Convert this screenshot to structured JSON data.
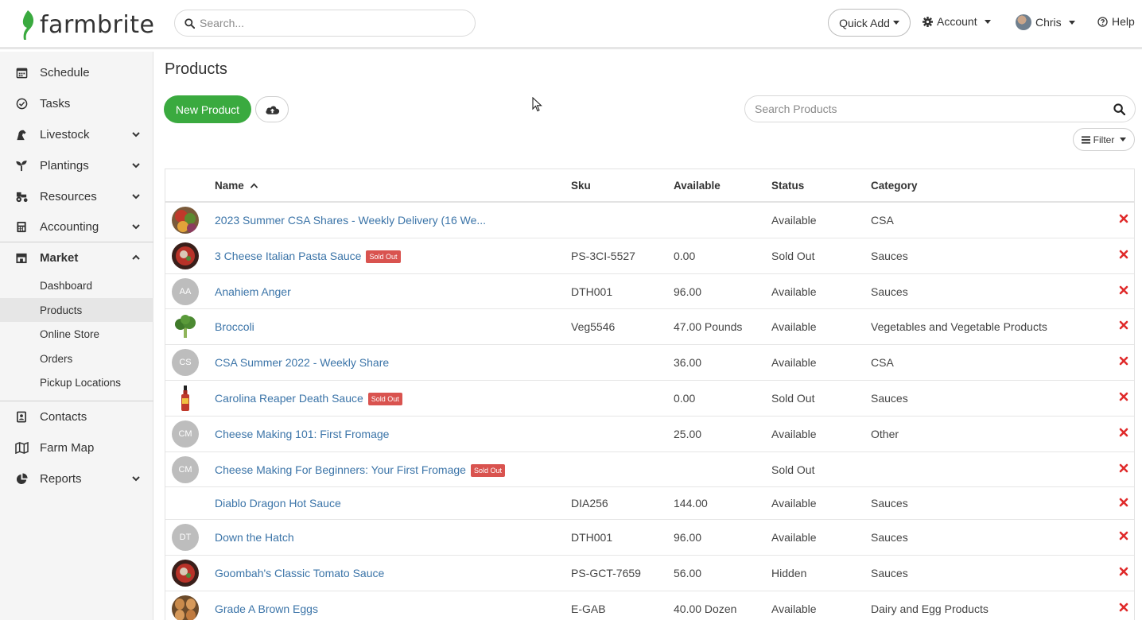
{
  "brand": {
    "name": "farmbrite",
    "accent": "#3aaa3f"
  },
  "header": {
    "search_placeholder": "Search...",
    "quick_add": "Quick Add",
    "account": "Account",
    "user": "Chris",
    "help": "Help"
  },
  "sidebar": {
    "items": [
      {
        "label": "Schedule",
        "icon": "calendar-icon"
      },
      {
        "label": "Tasks",
        "icon": "check-circle-icon"
      },
      {
        "label": "Livestock",
        "icon": "horse-icon"
      },
      {
        "label": "Plantings",
        "icon": "seedling-icon"
      },
      {
        "label": "Resources",
        "icon": "tractor-icon"
      },
      {
        "label": "Accounting",
        "icon": "calculator-icon"
      },
      {
        "label": "Market",
        "icon": "store-icon"
      },
      {
        "label": "Contacts",
        "icon": "address-book-icon"
      },
      {
        "label": "Farm Map",
        "icon": "map-icon"
      },
      {
        "label": "Reports",
        "icon": "pie-chart-icon"
      }
    ],
    "market_sub": [
      "Dashboard",
      "Products",
      "Online Store",
      "Orders",
      "Pickup Locations"
    ],
    "active_sub": "Products"
  },
  "page": {
    "title": "Products",
    "new_product": "New Product",
    "search_placeholder": "Search Products",
    "filter": "Filter"
  },
  "table": {
    "columns": [
      "Name",
      "Sku",
      "Available",
      "Status",
      "Category"
    ],
    "rows": [
      {
        "name": "2023 Summer CSA Shares - Weekly Delivery (16 We...",
        "sku": "",
        "available": "",
        "status": "Available",
        "category": "CSA",
        "thumb": "photo-veg",
        "sold_out": false
      },
      {
        "name": "3 Cheese Italian Pasta Sauce",
        "sku": "PS-3CI-5527",
        "available": "0.00",
        "status": "Sold Out",
        "category": "Sauces",
        "thumb": "photo-sauce",
        "sold_out": true
      },
      {
        "name": "Anahiem Anger",
        "sku": "DTH001",
        "available": "96.00",
        "status": "Available",
        "category": "Sauces",
        "thumb": "AA",
        "sold_out": false
      },
      {
        "name": "Broccoli",
        "sku": "Veg5546",
        "available": "47.00 Pounds",
        "status": "Available",
        "category": "Vegetables and Vegetable Products",
        "thumb": "photo-broccoli",
        "sold_out": false
      },
      {
        "name": "CSA Summer 2022 - Weekly Share",
        "sku": "",
        "available": "36.00",
        "status": "Available",
        "category": "CSA",
        "thumb": "CS",
        "sold_out": false
      },
      {
        "name": "Carolina Reaper Death Sauce",
        "sku": "",
        "available": "0.00",
        "status": "Sold Out",
        "category": "Sauces",
        "thumb": "photo-bottle",
        "sold_out": true
      },
      {
        "name": "Cheese Making 101: First Fromage",
        "sku": "",
        "available": "25.00",
        "status": "Available",
        "category": "Other",
        "thumb": "CM",
        "sold_out": false
      },
      {
        "name": "Cheese Making For Beginners: Your First Fromage",
        "sku": "",
        "available": "",
        "status": "Sold Out",
        "category": "",
        "thumb": "CM",
        "sold_out": true
      },
      {
        "name": "Diablo Dragon Hot Sauce",
        "sku": "DIA256",
        "available": "144.00",
        "status": "Available",
        "category": "Sauces",
        "thumb": "",
        "sold_out": false
      },
      {
        "name": "Down the Hatch",
        "sku": "DTH001",
        "available": "96.00",
        "status": "Available",
        "category": "Sauces",
        "thumb": "DT",
        "sold_out": false
      },
      {
        "name": "Goombah's Classic Tomato Sauce",
        "sku": "PS-GCT-7659",
        "available": "56.00",
        "status": "Hidden",
        "category": "Sauces",
        "thumb": "photo-sauce",
        "sold_out": false
      },
      {
        "name": "Grade A Brown Eggs",
        "sku": "E-GAB",
        "available": "40.00 Dozen",
        "status": "Available",
        "category": "Dairy and Egg Products",
        "thumb": "photo-eggs",
        "sold_out": false
      }
    ],
    "sold_out_badge": "Sold Out"
  }
}
